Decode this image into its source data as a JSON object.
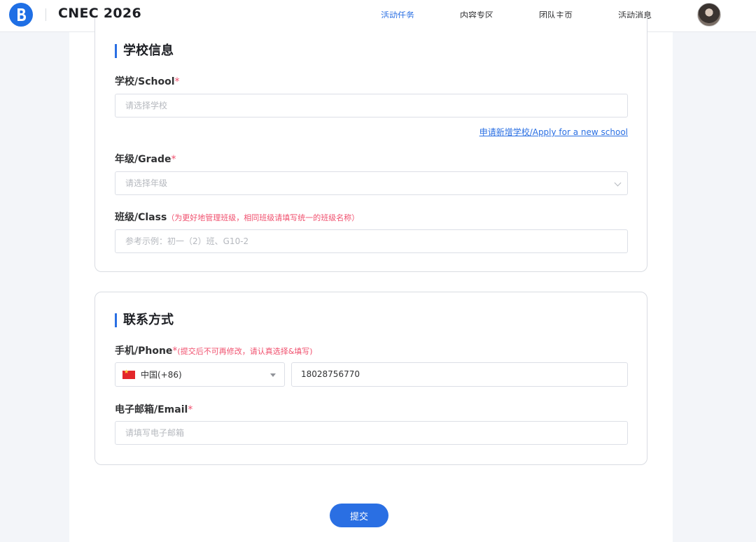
{
  "header": {
    "title": "CNEC 2026",
    "nav": [
      {
        "label": "活动任务",
        "active": true
      },
      {
        "label": "内容专区",
        "active": false
      },
      {
        "label": "团队主页",
        "active": false
      },
      {
        "label": "活动消息",
        "active": false
      }
    ]
  },
  "school_section": {
    "title": "学校信息",
    "school": {
      "label": "学校/School",
      "required": "*",
      "placeholder": "请选择学校"
    },
    "apply_link": "申请新增学校/Apply for a new school",
    "grade": {
      "label": "年级/Grade",
      "required": "*",
      "placeholder": "请选择年级"
    },
    "class": {
      "label": "班级/Class",
      "hint": "（为更好地管理班级，相同班级请填写统一的班级名称）",
      "placeholder": "参考示例：初一（2）班、G10-2"
    }
  },
  "contact_section": {
    "title": "联系方式",
    "phone": {
      "label": "手机/Phone",
      "required": "*",
      "hint": "(提交后不可再修改，请认真选择&填写)",
      "country": "中国(+86)",
      "value": "18028756770"
    },
    "email": {
      "label": "电子邮箱/Email",
      "required": "*",
      "placeholder": "请填写电子邮箱"
    }
  },
  "submit_label": "提交",
  "colors": {
    "accent": "#2a6fe3",
    "required": "#f0506e"
  }
}
